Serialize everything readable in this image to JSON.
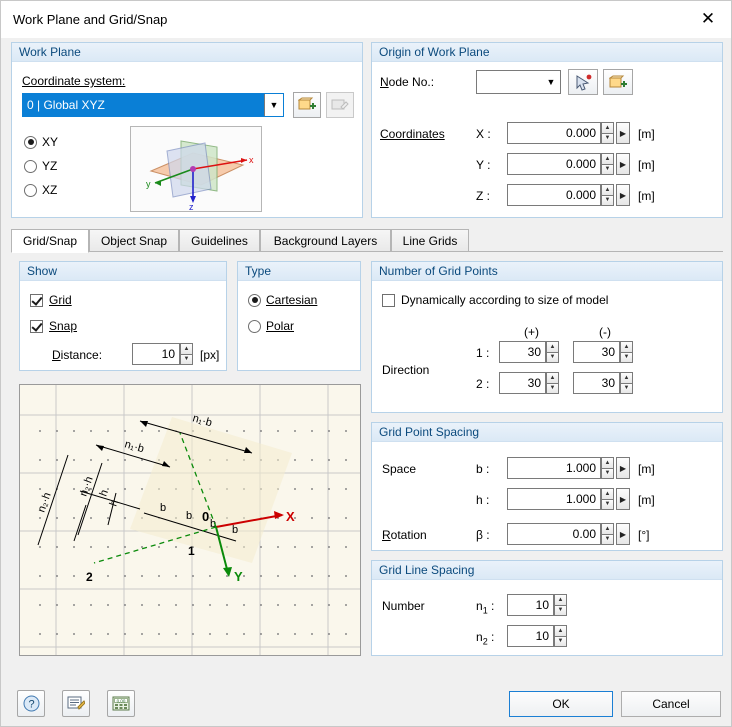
{
  "window": {
    "title": "Work Plane and Grid/Snap",
    "close_label": "✕"
  },
  "work_plane": {
    "title": "Work Plane",
    "coordinate_system_label": "Coordinate system:",
    "coordinate_system_value": "0 | Global XYZ",
    "planes": [
      {
        "label": "XY",
        "selected": true
      },
      {
        "label": "YZ",
        "selected": false
      },
      {
        "label": "XZ",
        "selected": false
      }
    ],
    "new_cs_icon": "new-coordinate-system-icon",
    "edit_cs_icon": "edit-coordinate-system-icon"
  },
  "origin": {
    "title": "Origin of Work Plane",
    "node_no_label": "Node No.:",
    "node_no_value": "",
    "pick_icon": "pick-node-icon",
    "new_node_icon": "new-node-icon",
    "coordinates_label": "Coordinates",
    "rows": [
      {
        "axis": "X :",
        "value": "0.000",
        "unit": "[m]"
      },
      {
        "axis": "Y :",
        "value": "0.000",
        "unit": "[m]"
      },
      {
        "axis": "Z :",
        "value": "0.000",
        "unit": "[m]"
      }
    ]
  },
  "tabs": [
    {
      "label": "Grid/Snap",
      "active": true
    },
    {
      "label": "Object Snap",
      "active": false
    },
    {
      "label": "Guidelines",
      "active": false
    },
    {
      "label": "Background Layers",
      "active": false
    },
    {
      "label": "Line Grids",
      "active": false
    }
  ],
  "show": {
    "title": "Show",
    "grid": {
      "label": "Grid",
      "checked": true
    },
    "snap": {
      "label": "Snap",
      "checked": true
    },
    "distance_label": "Distance:",
    "distance_value": "10",
    "distance_unit": "[px]"
  },
  "type": {
    "title": "Type",
    "options": [
      {
        "label": "Cartesian",
        "selected": true
      },
      {
        "label": "Polar",
        "selected": false
      }
    ]
  },
  "grid_points": {
    "title": "Number of Grid Points",
    "dynamic_label": "Dynamically according to size of model",
    "dynamic_checked": false,
    "col_plus": "(+)",
    "col_minus": "(-)",
    "direction_label": "Direction",
    "rows": [
      {
        "name": "1 :",
        "plus": "30",
        "minus": "30"
      },
      {
        "name": "2 :",
        "plus": "30",
        "minus": "30"
      }
    ]
  },
  "grid_point_spacing": {
    "title": "Grid Point Spacing",
    "space_label": "Space",
    "rotation_label": "Rotation",
    "rows": [
      {
        "sym": "b :",
        "value": "1.000",
        "unit": "[m]"
      },
      {
        "sym": "h :",
        "value": "1.000",
        "unit": "[m]"
      },
      {
        "sym": "β :",
        "value": "0.00",
        "unit": "[°]"
      }
    ]
  },
  "grid_line_spacing": {
    "title": "Grid Line Spacing",
    "number_label": "Number",
    "rows": [
      {
        "sym": "n",
        "sub": "1",
        "suffix": " :",
        "value": "10"
      },
      {
        "sym": "n",
        "sub": "2",
        "suffix": " :",
        "value": "10"
      }
    ]
  },
  "preview": {
    "name": "grid-preview-diagram",
    "labels": {
      "origin": "0",
      "axis_x": "X",
      "axis_y": "Y",
      "dir1": "1",
      "dir2": "2",
      "n1b": "n₁·b",
      "n1b_2": "n₁·b",
      "n2h": "n₂·h",
      "n2h_2": "n₂·h",
      "b": "b",
      "h": "h"
    }
  },
  "footer": {
    "help_icon": "help-icon",
    "notes_icon": "comment-icon",
    "calc_icon": "units-icon",
    "ok_label": "OK",
    "cancel_label": "Cancel"
  }
}
